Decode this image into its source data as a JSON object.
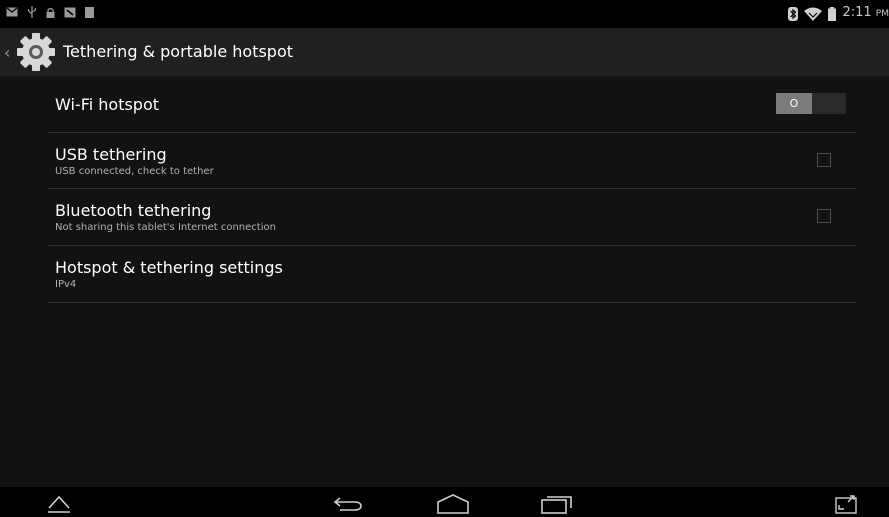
{
  "status_bar": {
    "left_icons": [
      "mail-icon",
      "usb-icon",
      "lock-icon",
      "screenshot-icon",
      "storage-icon"
    ],
    "right_icons": [
      "bluetooth-icon",
      "wifi-icon",
      "battery-icon"
    ],
    "time": "2:11",
    "ampm": "PM"
  },
  "action_bar": {
    "title": "Tethering & portable hotspot",
    "icon": "settings-gear-icon"
  },
  "preferences": [
    {
      "title": "Wi-Fi hotspot",
      "summary": "",
      "control": "switch",
      "state": "off"
    },
    {
      "title": "USB tethering",
      "summary": "USB connected, check to tether",
      "control": "checkbox",
      "checked": false
    },
    {
      "title": "Bluetooth tethering",
      "summary": "Not sharing this tablet's Internet connection",
      "control": "checkbox",
      "checked": false
    },
    {
      "title": "Hotspot & tethering settings",
      "summary": "IPv4",
      "control": "none"
    }
  ],
  "toggle": {
    "off_label": "O"
  },
  "nav_bar": [
    "hide-keyboard-icon",
    "back-icon",
    "home-icon",
    "recents-icon",
    "expand-icon"
  ],
  "colors": {
    "background": "#121212",
    "action_bar": "#202020",
    "divider": "#2f2f2f",
    "switch_thumb": "#7b7b7b"
  }
}
